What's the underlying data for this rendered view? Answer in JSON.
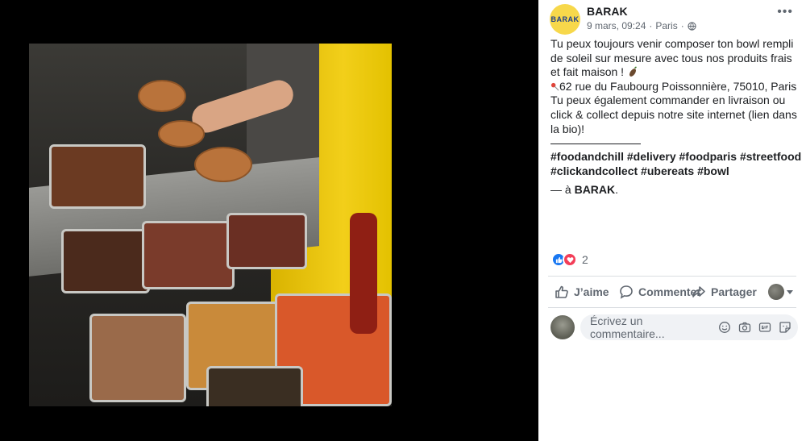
{
  "post": {
    "page_name": "BARAK",
    "avatar_text": "BARAK",
    "timestamp": "9 mars, 09:24",
    "location": "Paris",
    "privacy_icon": "globe-icon",
    "more_icon": "more-icon",
    "text_line1": "Tu peux toujours venir composer ton bowl rempli de soleil sur mesure avec tous nos produits frais et fait maison ! ",
    "address": "62 rue du Faubourg Poissonnière, 75010, Paris",
    "text_line2": "Tu peux également commander en livraison ou click & collect depuis notre site internet (lien dans la bio)!",
    "hashtags": "#foodandchill #delivery #foodparis #streetfood #clickandcollect #ubereats #bowl",
    "tagged_prefix": "— à ",
    "tagged_place": "BARAK",
    "tagged_suffix": "."
  },
  "reactions": {
    "count": "2"
  },
  "actions": {
    "like_label": "J’aime",
    "comment_label": "Commenter",
    "share_label": "Partager"
  },
  "comment_input": {
    "placeholder": "Écrivez un commentaire..."
  },
  "colors": {
    "accent": "#1877f2",
    "love": "#f33e58",
    "muted": "#606770",
    "avatar_bg": "#f7d84b"
  }
}
